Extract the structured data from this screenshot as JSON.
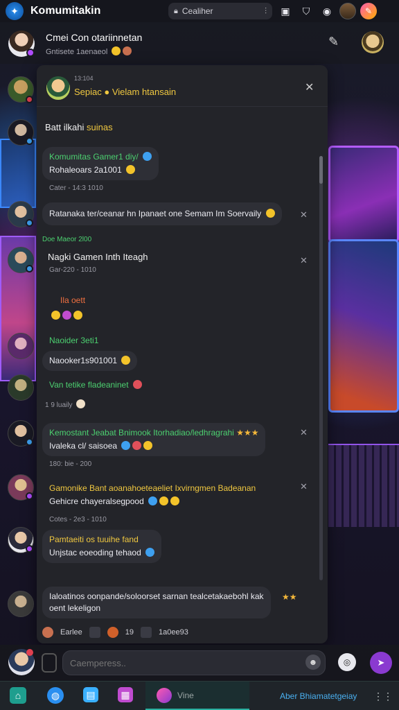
{
  "app": {
    "title": "Komumitakin"
  },
  "search": {
    "text": "Cealiher"
  },
  "header": {
    "title": "Cmei Con otariinnetan",
    "subtitle": "Gntisete 1aenaeol"
  },
  "panel": {
    "time": "13:104",
    "name": "Sepiac ● Vielam htansain",
    "section_label_a": "Batt ilkahi",
    "section_label_b": "suinas"
  },
  "messages": [
    {
      "user": "Komumitas Gamer1 diy/",
      "user_color": "#4cd070",
      "text": "Rohaleoars 2a1001",
      "meta": "Cater - 14:3 1010"
    },
    {
      "text": "Ratanaka ter/ceanar hn Ipanaet one Semam Im Soervaily",
      "highlight": "Semam Im Soervaily"
    },
    {
      "user": "Doe Maeor 2l00",
      "user_color": "#4cd070",
      "text": "Nagki Gamen Inth Iteagh",
      "meta": "Gar-220 - 1010"
    },
    {
      "user": "Ila oett",
      "user_color": "#f07040"
    },
    {
      "user": "Naoider 3eti1",
      "user_color": "#4cd070",
      "text": "Naooker1s901001"
    },
    {
      "user": "Van tetike fladeaninet",
      "user_color": "#4cd070",
      "meta": "1 9 luaily"
    },
    {
      "user": "Kemostant Jeabat Bnimook Itorhadiao/ledhragrahi",
      "user_color": "#4cd070",
      "text": "Ivaleka cl/ saisoea",
      "meta": "180: bie - 200"
    },
    {
      "user": "Gamonike Bant aoanahoeteaeliet Ixvirngmen Badeanan",
      "user_color": "#f0c840",
      "text": "Gehicre chayeralsegpood",
      "meta": "Cotes - 2e3 - 1010"
    },
    {
      "user": "Pamtaeiti os tuuihe fand",
      "user_color": "#f0c840",
      "text": "Unjstac eoeoding tehaod"
    },
    {
      "text": "Ialoatinos oonpande/soloorset sarnan tealcetakaebohl kak oent lekeligon"
    }
  ],
  "footer": {
    "label_a": "Earlee",
    "label_b": "19",
    "label_c": "1a0ee93"
  },
  "composer": {
    "placeholder": "Caemperess.."
  },
  "bottomnav": {
    "active_label": "Vine",
    "right_label": "Aber Bhiamatetgeiay"
  },
  "colors": {
    "accent": "#8a3ad0",
    "green": "#4cd070",
    "yellow": "#f0c840",
    "panel": "#232429"
  }
}
